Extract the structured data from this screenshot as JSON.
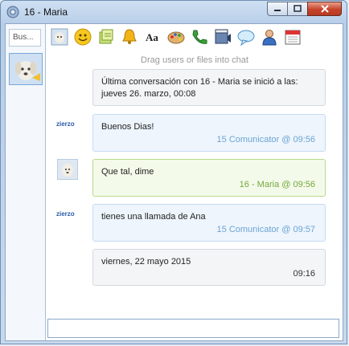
{
  "window": {
    "title": "16 - Maria"
  },
  "sidebar": {
    "search_placeholder": "Bus..."
  },
  "toolbar": [
    "contact-photo-icon",
    "smiley-icon",
    "files-icon",
    "bell-icon",
    "font-icon",
    "palette-icon",
    "phone-icon",
    "video-icon",
    "speech-bubble-icon",
    "user-icon",
    "calendar-icon"
  ],
  "chat": {
    "drag_hint": "Drag users or files into chat",
    "last_conversation_line1": "Última conversación con 16 - Maria se inició a las:",
    "last_conversation_line2": "jueves 26. marzo, 00:08",
    "messages": [
      {
        "text": "Buenos Dias!",
        "meta": "15 Comunicator @ 09:56"
      },
      {
        "text": "Que tal, dime",
        "meta": "16 - Maria @ 09:56"
      },
      {
        "text": "tienes una llamada de Ana",
        "meta": "15 Comunicator @ 09:57"
      }
    ],
    "day_separator": {
      "text": "viernes, 22 mayo 2015",
      "time": "09:16"
    },
    "logo_text": "zierzo"
  },
  "colors": {
    "accent": "#6aa4d3",
    "green_meta": "#74a83d"
  }
}
